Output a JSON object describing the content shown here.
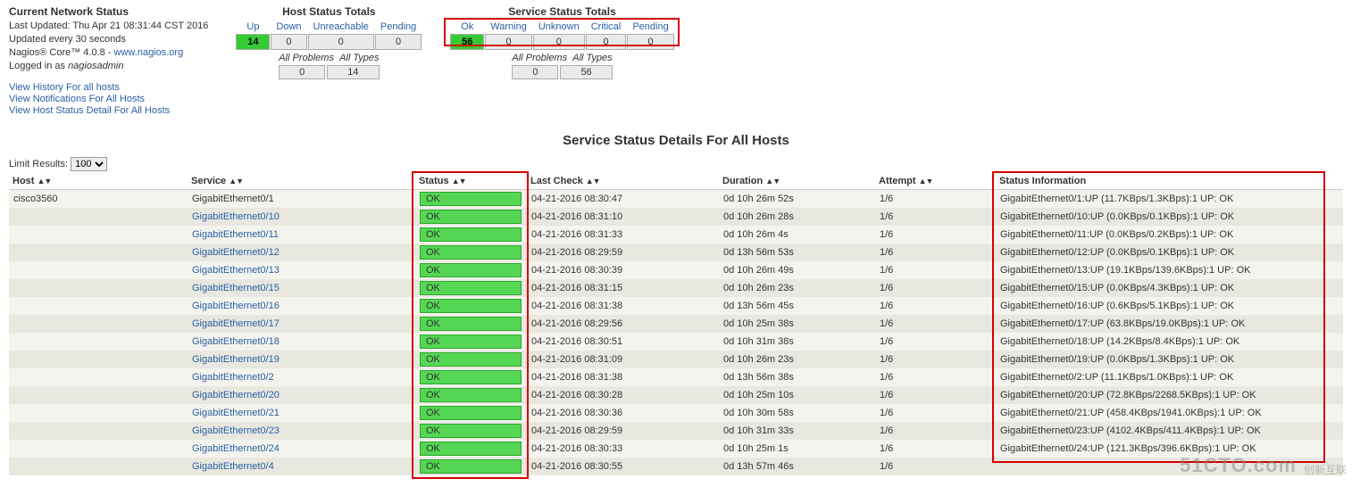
{
  "status": {
    "title": "Current Network Status",
    "updated": "Last Updated: Thu Apr 21 08:31:44 CST 2016",
    "refresh": "Updated every 30 seconds",
    "product_prefix": "Nagios® Core™ 4.0.8 - ",
    "product_link": "www.nagios.org",
    "logged_prefix": "Logged in as ",
    "logged_user": "nagiosadmin",
    "nav": [
      "View History For all hosts",
      "View Notifications For All Hosts",
      "View Host Status Detail For All Hosts"
    ]
  },
  "host_totals": {
    "title": "Host Status Totals",
    "headers": [
      "Up",
      "Down",
      "Unreachable",
      "Pending"
    ],
    "values": [
      "14",
      "0",
      "0",
      "0"
    ],
    "problems_label": "All Problems",
    "types_label": "All Types",
    "problems": "0",
    "types": "14"
  },
  "service_totals": {
    "title": "Service Status Totals",
    "headers": [
      "Ok",
      "Warning",
      "Unknown",
      "Critical",
      "Pending"
    ],
    "values": [
      "56",
      "0",
      "0",
      "0",
      "0"
    ],
    "problems_label": "All Problems",
    "types_label": "All Types",
    "problems": "0",
    "types": "56"
  },
  "page_title": "Service Status Details For All Hosts",
  "limit": {
    "label": "Limit Results:",
    "value": "100"
  },
  "columns": {
    "host": "Host",
    "service": "Service",
    "status": "Status",
    "last_check": "Last Check",
    "duration": "Duration",
    "attempt": "Attempt",
    "info": "Status Information"
  },
  "rows": [
    {
      "host": "cisco3560",
      "service": "GigabitEthernet0/1",
      "svc_link": false,
      "status": "OK",
      "check": "04-21-2016 08:30:47",
      "dur": "0d 10h 26m 52s",
      "att": "1/6",
      "info": "GigabitEthernet0/1:UP (11.7KBps/1.3KBps):1 UP: OK"
    },
    {
      "host": "",
      "service": "GigabitEthernet0/10",
      "svc_link": true,
      "status": "OK",
      "check": "04-21-2016 08:31:10",
      "dur": "0d 10h 26m 28s",
      "att": "1/6",
      "info": "GigabitEthernet0/10:UP (0.0KBps/0.1KBps):1 UP: OK"
    },
    {
      "host": "",
      "service": "GigabitEthernet0/11",
      "svc_link": true,
      "status": "OK",
      "check": "04-21-2016 08:31:33",
      "dur": "0d 10h 26m 4s",
      "att": "1/6",
      "info": "GigabitEthernet0/11:UP (0.0KBps/0.2KBps):1 UP: OK"
    },
    {
      "host": "",
      "service": "GigabitEthernet0/12",
      "svc_link": true,
      "status": "OK",
      "check": "04-21-2016 08:29:59",
      "dur": "0d 13h 56m 53s",
      "att": "1/6",
      "info": "GigabitEthernet0/12:UP (0.0KBps/0.1KBps):1 UP: OK"
    },
    {
      "host": "",
      "service": "GigabitEthernet0/13",
      "svc_link": true,
      "status": "OK",
      "check": "04-21-2016 08:30:39",
      "dur": "0d 10h 26m 49s",
      "att": "1/6",
      "info": "GigabitEthernet0/13:UP (19.1KBps/139.6KBps):1 UP: OK"
    },
    {
      "host": "",
      "service": "GigabitEthernet0/15",
      "svc_link": true,
      "status": "OK",
      "check": "04-21-2016 08:31:15",
      "dur": "0d 10h 26m 23s",
      "att": "1/6",
      "info": "GigabitEthernet0/15:UP (0.0KBps/4.3KBps):1 UP: OK"
    },
    {
      "host": "",
      "service": "GigabitEthernet0/16",
      "svc_link": true,
      "status": "OK",
      "check": "04-21-2016 08:31:38",
      "dur": "0d 13h 56m 45s",
      "att": "1/6",
      "info": "GigabitEthernet0/16:UP (0.6KBps/5.1KBps):1 UP: OK"
    },
    {
      "host": "",
      "service": "GigabitEthernet0/17",
      "svc_link": true,
      "status": "OK",
      "check": "04-21-2016 08:29:56",
      "dur": "0d 10h 25m 38s",
      "att": "1/6",
      "info": "GigabitEthernet0/17:UP (63.8KBps/19.0KBps):1 UP: OK"
    },
    {
      "host": "",
      "service": "GigabitEthernet0/18",
      "svc_link": true,
      "status": "OK",
      "check": "04-21-2016 08:30:51",
      "dur": "0d 10h 31m 38s",
      "att": "1/6",
      "info": "GigabitEthernet0/18:UP (14.2KBps/8.4KBps):1 UP: OK"
    },
    {
      "host": "",
      "service": "GigabitEthernet0/19",
      "svc_link": true,
      "status": "OK",
      "check": "04-21-2016 08:31:09",
      "dur": "0d 10h 26m 23s",
      "att": "1/6",
      "info": "GigabitEthernet0/19:UP (0.0KBps/1.3KBps):1 UP: OK"
    },
    {
      "host": "",
      "service": "GigabitEthernet0/2",
      "svc_link": true,
      "status": "OK",
      "check": "04-21-2016 08:31:38",
      "dur": "0d 13h 56m 38s",
      "att": "1/6",
      "info": "GigabitEthernet0/2:UP (11.1KBps/1.0KBps):1 UP: OK"
    },
    {
      "host": "",
      "service": "GigabitEthernet0/20",
      "svc_link": true,
      "status": "OK",
      "check": "04-21-2016 08:30:28",
      "dur": "0d 10h 25m 10s",
      "att": "1/6",
      "info": "GigabitEthernet0/20:UP (72.8KBps/2268.5KBps):1 UP: OK"
    },
    {
      "host": "",
      "service": "GigabitEthernet0/21",
      "svc_link": true,
      "status": "OK",
      "check": "04-21-2016 08:30:36",
      "dur": "0d 10h 30m 58s",
      "att": "1/6",
      "info": "GigabitEthernet0/21:UP (458.4KBps/1941.0KBps):1 UP: OK"
    },
    {
      "host": "",
      "service": "GigabitEthernet0/23",
      "svc_link": true,
      "status": "OK",
      "check": "04-21-2016 08:29:59",
      "dur": "0d 10h 31m 33s",
      "att": "1/6",
      "info": "GigabitEthernet0/23:UP (4102.4KBps/411.4KBps):1 UP: OK"
    },
    {
      "host": "",
      "service": "GigabitEthernet0/24",
      "svc_link": true,
      "status": "OK",
      "check": "04-21-2016 08:30:33",
      "dur": "0d 10h 25m 1s",
      "att": "1/6",
      "info": "GigabitEthernet0/24:UP (121.3KBps/396.6KBps):1 UP: OK"
    },
    {
      "host": "",
      "service": "GigabitEthernet0/4",
      "svc_link": true,
      "status": "OK",
      "check": "04-21-2016 08:30:55",
      "dur": "0d 13h 57m 46s",
      "att": "1/6",
      "info": ""
    }
  ],
  "watermark": {
    "big": "51CTO.com",
    "sm": "创新互联"
  }
}
